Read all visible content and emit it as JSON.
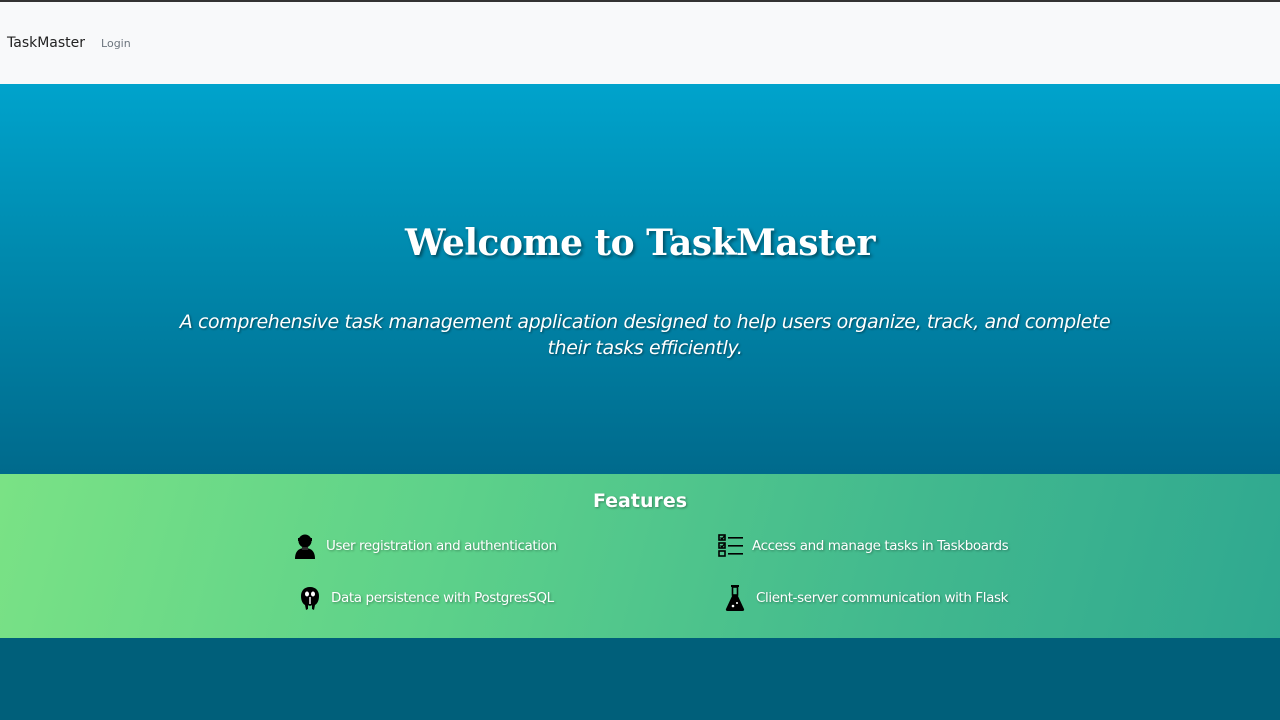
{
  "navbar": {
    "brand": "TaskMaster",
    "links": [
      {
        "label": "Login"
      }
    ]
  },
  "hero": {
    "title": "Welcome to TaskMaster",
    "subtitle": "A comprehensive task management application designed to help users organize, track, and complete their tasks efficiently."
  },
  "features": {
    "title": "Features",
    "items": [
      {
        "icon": "user-icon",
        "text": "User registration and authentication"
      },
      {
        "icon": "checklist-icon",
        "text": "Access and manage tasks in Taskboards"
      },
      {
        "icon": "postgresql-icon",
        "text": "Data persistence with PostgresSQL"
      },
      {
        "icon": "flask-icon",
        "text": "Client-server communication with Flask"
      }
    ]
  },
  "colors": {
    "navbar_bg": "#f8f9fa",
    "hero_top": "#00a3cc",
    "hero_bottom": "#006a8c",
    "features_left": "#7ae285",
    "features_right": "#2fa890",
    "bottom_band": "#005f7a"
  }
}
